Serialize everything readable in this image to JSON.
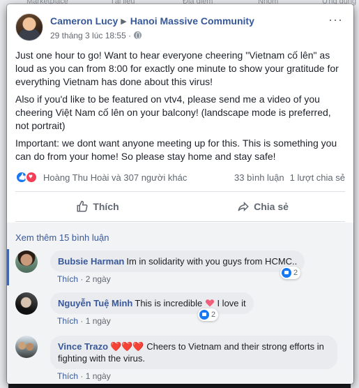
{
  "background_nav": [
    "Marketplace",
    "Tài liệu",
    "Địa điểm",
    "Nhóm",
    "Ứng dụng"
  ],
  "post": {
    "author": "Cameron Lucy",
    "group": "Hanoi Massive Community",
    "timestamp": "29 tháng 3 lúc 18:55 ·",
    "paragraphs": [
      "Just one hour to go! Want to hear everyone cheering \"Vietnam cố lên\" as loud as you can from 8:00 for exactly one minute to show your gratitude for everything Vietnam has done about this virus!",
      "Also if you'd like to be featured on vtv4, please send me a video of you cheering Việt Nam cố lên on your balcony! (landscape mode is preferred, not portrait)",
      "Important: we dont want anyone meeting up for this. This is something you can do from your home! So please stay home and stay safe!"
    ],
    "reactors": "Hoàng Thu Hoài và 307 người khác",
    "comments_count": "33 bình luận",
    "shares_count": "1 lượt chia sẻ",
    "like_label": "Thích",
    "share_label": "Chia sẻ"
  },
  "comments_section": {
    "view_more": "Xem thêm 15 bình luận",
    "items": [
      {
        "name": "Bubsie Harman",
        "text": "Im in solidarity with you guys from HCMC..",
        "reactions": "2",
        "like": "Thích",
        "time": "· 2 ngày"
      },
      {
        "name": "Nguyễn Tuệ Minh",
        "text_before": "This is incredible",
        "text_after": "I love it",
        "reactions": "2",
        "like": "Thích",
        "time": "· 1 ngày"
      },
      {
        "name": "Vince Trazo",
        "hearts": "❤️❤️❤️",
        "text": "Cheers to Vietnam and their strong efforts in fighting with the virus.",
        "like": "Thích",
        "time": "· 1 ngày"
      }
    ]
  },
  "colors": {
    "link": "#385898",
    "like_blue": "#1877f2",
    "love_red": "#f33e58"
  }
}
